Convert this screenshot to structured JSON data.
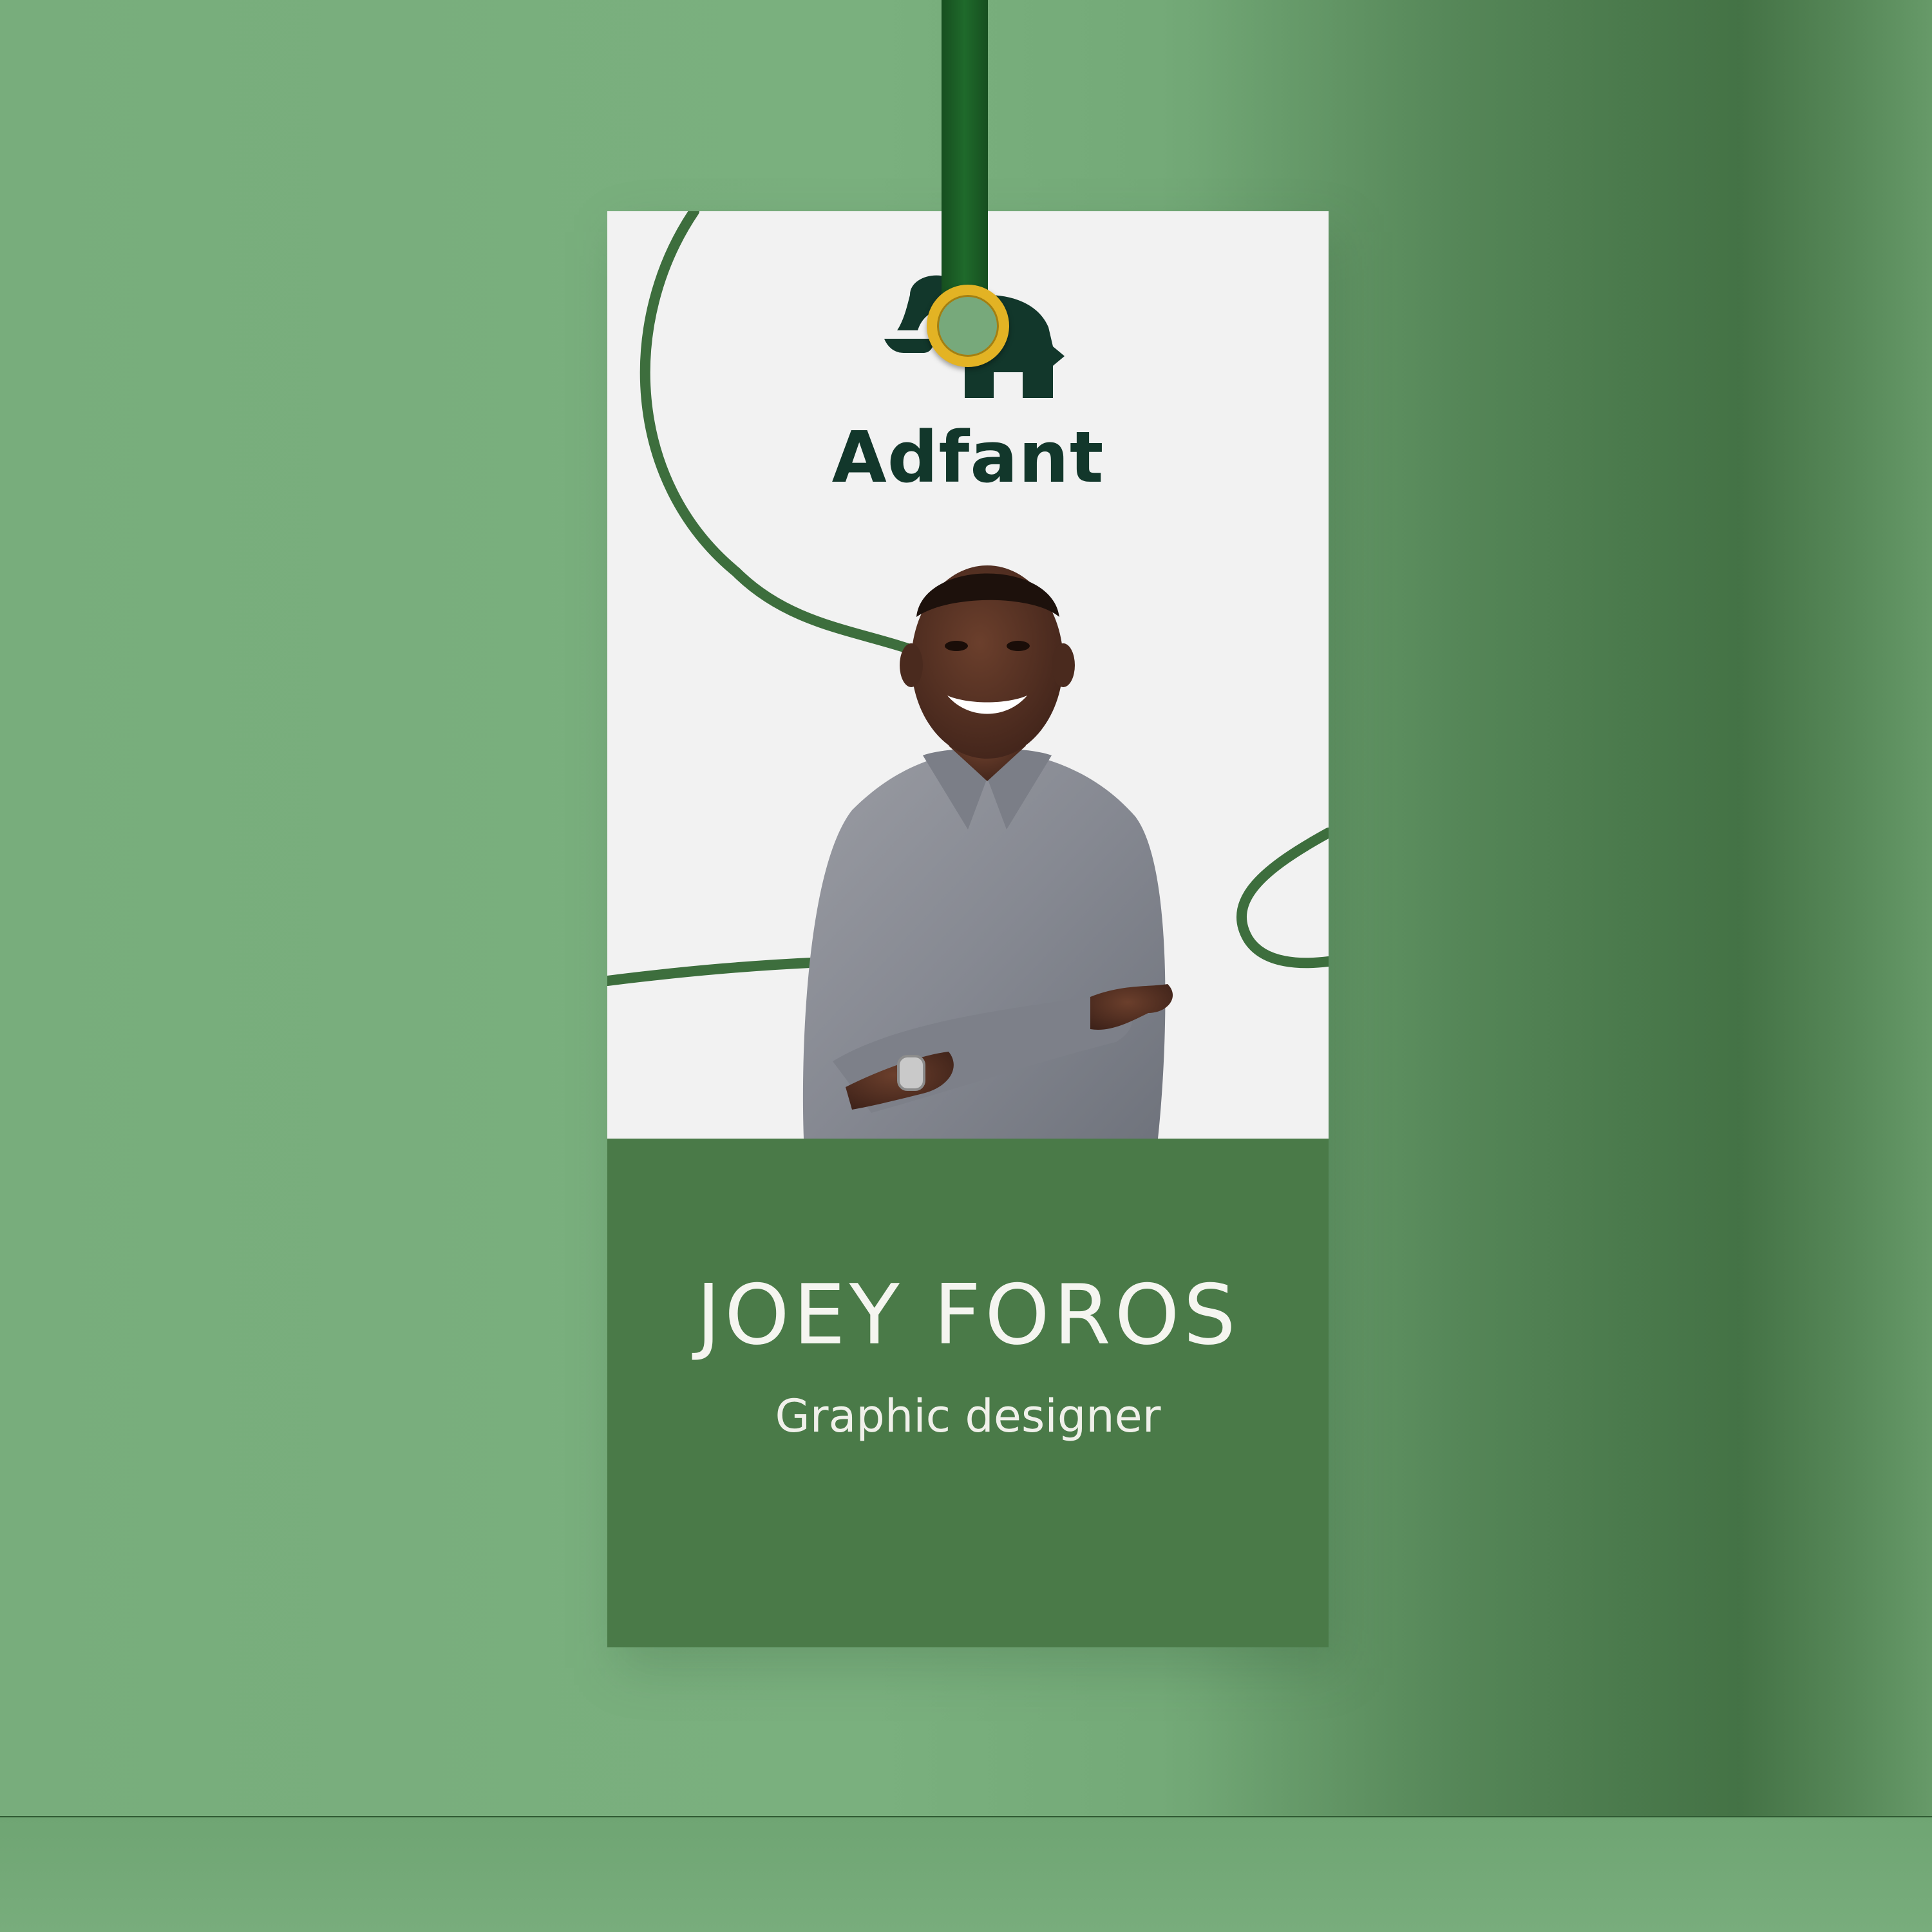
{
  "badge": {
    "brand_name": "Adfant",
    "person_name": "JOEY FOROS",
    "job_title": "Graphic designer",
    "logo_icon": "elephant-icon",
    "colors": {
      "background": "#78ad7c",
      "card_top": "#f2f2f2",
      "card_bottom": "#4a7a48",
      "brand_text": "#12372b",
      "strap": "#1f6a2b",
      "eyelet": "#e3b324"
    }
  }
}
